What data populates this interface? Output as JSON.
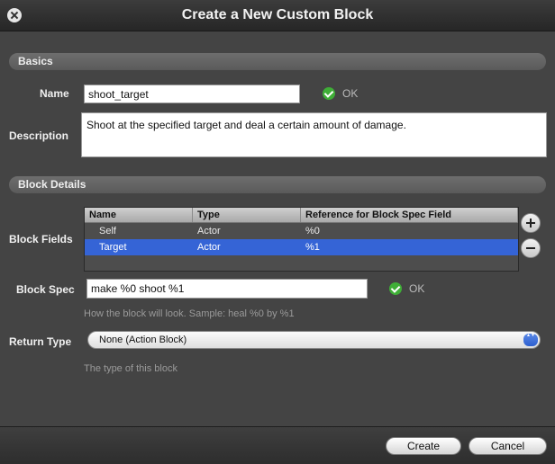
{
  "window": {
    "title": "Create a New Custom Block"
  },
  "basics": {
    "section_title": "Basics",
    "name_label": "Name",
    "name_value": "shoot_target",
    "name_status": "OK",
    "description_label": "Description",
    "description_value": "Shoot at the specified target and deal a certain amount of damage."
  },
  "details": {
    "section_title": "Block Details",
    "fields_label": "Block Fields",
    "table": {
      "headers": [
        "Name",
        "Type",
        "Reference for Block Spec Field"
      ],
      "rows": [
        [
          "Self",
          "Actor",
          "%0"
        ],
        [
          "Target",
          "Actor",
          "%1"
        ]
      ],
      "selected_row": 1
    },
    "block_spec_label": "Block Spec",
    "block_spec_value": "make %0 shoot %1",
    "block_spec_status": "OK",
    "block_spec_hint": "How the block will look. Sample: heal %0 by %1",
    "return_type_label": "Return Type",
    "return_type_value": "None (Action Block)",
    "return_type_hint": "The type of this block"
  },
  "footer": {
    "create_label": "Create",
    "cancel_label": "Cancel"
  },
  "icons": {
    "close": "close-icon",
    "ok": "check-circle-icon",
    "add": "plus-icon",
    "remove": "minus-icon"
  },
  "colors": {
    "selection": "#3564d6",
    "ok_green": "#3fae37",
    "dialog_bg": "#444444"
  }
}
